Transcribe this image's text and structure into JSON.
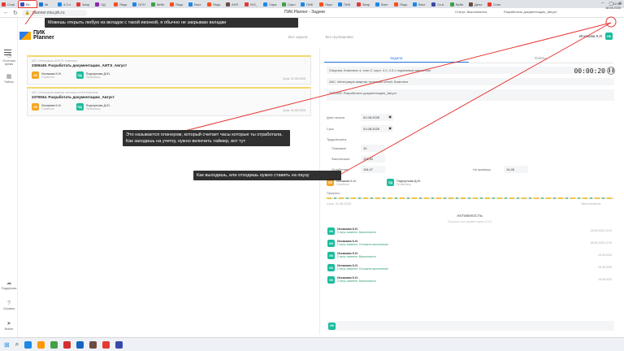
{
  "browser": {
    "tabs": [
      {
        "label": "Стан",
        "color": "#e53935"
      },
      {
        "label": "Вх: ",
        "color": "#3f51b5",
        "active": true
      },
      {
        "label": "Mi",
        "color": "#1976d2"
      },
      {
        "label": "4.3 п",
        "color": "#1e88e5"
      },
      {
        "label": "Запр",
        "color": "#e53935"
      },
      {
        "label": "ОД",
        "color": "#8e24aa"
      },
      {
        "label": "Яндс",
        "color": "#f4511e"
      },
      {
        "label": "ОСН",
        "color": "#1e88e5"
      },
      {
        "label": "Вебп",
        "color": "#43a047"
      },
      {
        "label": "Яндс",
        "color": "#f4511e"
      },
      {
        "label": "Вист",
        "color": "#1e88e5"
      },
      {
        "label": "Яндс",
        "color": "#f4511e"
      },
      {
        "label": "АНП",
        "color": "#6d4c41"
      },
      {
        "label": "002_",
        "color": "#e53935"
      },
      {
        "label": "Спра",
        "color": "#1e88e5"
      },
      {
        "label": "Сапо",
        "color": "#43a047"
      },
      {
        "label": "ПИК",
        "color": "#1e88e5"
      },
      {
        "label": "Перс",
        "color": "#f4511e"
      },
      {
        "label": "ПИК",
        "color": "#1e88e5"
      },
      {
        "label": "Запр",
        "color": "#e53935"
      },
      {
        "label": "Вист",
        "color": "#1e88e5"
      },
      {
        "label": "Яндс",
        "color": "#f4511e"
      },
      {
        "label": "Вист",
        "color": "#1e88e5"
      },
      {
        "label": "Ск.Ь.",
        "color": "#3949ab"
      },
      {
        "label": "Вебп",
        "color": "#43a047"
      },
      {
        "label": "Дело",
        "color": "#6d4c41"
      },
      {
        "label": "Стан",
        "color": "#e53935"
      }
    ],
    "url": "planner.mia.pik.ru",
    "title": "ПИК.Planner - Задачи"
  },
  "header": {
    "status_label": "Статус: Выполняется",
    "task_label": "Разработать документацию_Август",
    "view_tabs": [
      "Все задачи",
      "Без группировки"
    ],
    "user_name": "Исхакова К.И.",
    "user_initials": "ИК"
  },
  "logo": {
    "line1": "ПИК",
    "line2": "Planner"
  },
  "sidebar": {
    "items": [
      {
        "label": "Отчетная\nвремя",
        "icon": "clock-icon"
      },
      {
        "label": "Табель",
        "icon": "table-icon"
      },
      {
        "label": "Поддержка",
        "icon": "cloud-icon"
      },
      {
        "label": "Справка",
        "icon": "help-icon"
      },
      {
        "label": "Выйти",
        "icon": "send-icon"
      }
    ]
  },
  "tasks": [
    {
      "path": "АКС. Интеграция АСКУЭ. Комплекс",
      "name": "2369449. Разработать документацию_АИТЭ_Август",
      "assignee": {
        "name": "Исхакова К.И.",
        "role": "Отработал",
        "initials": "ИК"
      },
      "reviewer": {
        "name": "Подгорнова Д.Ю.",
        "role": "Проверяющ",
        "initials": "ПД"
      },
      "due": "Срок: 31.08.2025"
    },
    {
      "path": "АКС. Интеграция квартир тепловых сетей Комплекс",
      "name": "2370934. Разработать документацию_Август",
      "assignee": {
        "name": "Исхакова К.И.",
        "role": "Отработал",
        "initials": "ИК"
      },
      "reviewer": {
        "name": "Подгорнова Д.Ю.",
        "role": "Проверяющ",
        "initials": "ПД"
      },
      "due": "Срок: 31.08.2025"
    }
  ],
  "panel": {
    "tabs": [
      "Задача",
      "Файлы"
    ],
    "field1": "Озерная, Комплекс 4, этап 2, корп. 4.2, 4.3 с подземным паркингом",
    "field2": "АКС. Интеграция квартир тепловых сетей. Комплект",
    "field3": "2370934. Разработать документацию_Август",
    "timer": "00:00:20",
    "labels": {
      "start": "Дата начала",
      "end": "Срок",
      "labor": "Трудозатраты",
      "planned": "Плановые",
      "actual": "Фактические",
      "worked": "Отработано",
      "to_check": "На проверку",
      "progress": "Прогресс",
      "period": "Срок: 31.08.2025",
      "remaining": "Выполняется"
    },
    "values": {
      "start": "01.08.2025",
      "end": "31.08.2025",
      "planned": "10",
      "actual": "126,92",
      "worked": "116,47",
      "to_check": "14,46"
    },
    "people": [
      {
        "name": "Исхакова К.И.",
        "role": "Отработал",
        "initials": "ИК"
      },
      {
        "name": "Подгорнова Д.Ю.",
        "role": "Проверяющ",
        "initials": "ПД"
      }
    ]
  },
  "activity": {
    "title": "АКТИВНОСТЬ",
    "subtitle": "Показать все комментарии (137)",
    "items": [
      {
        "name": "Исхакова К.И.",
        "status": "Статус изменен: Выполняется",
        "time": "18.08.2025 12:00"
      },
      {
        "name": "Исхакова К.И.",
        "status": "Статус изменен: Отложено выполнение",
        "time": "18.08.2025 12:00"
      },
      {
        "name": "Исхакова К.И.",
        "status": "Статус изменен: Выполняется",
        "time": "18.08.2025"
      },
      {
        "name": "Исхакова К.И.",
        "status": "Статус изменен: Отложено выполнение",
        "time": "18.08.2025"
      },
      {
        "name": "Исхакова К.И.",
        "status": "Статус изменен: Выполняется",
        "time": "18.08.2025"
      }
    ],
    "composer_initials": "ИК"
  },
  "tooltips": {
    "tip1": "Можешь открыть любую из вкладок с такой иконкой, я обычно не закрываю вкладки",
    "tip2": "Это называется планером, который считает часы которые ты отработала. Как заходишь на учетку, нужно включить таймер, вот тут",
    "tip3": "Как выходишь, или отходишь нужно ставить на паузу"
  },
  "taskbar": {
    "time": "12:00",
    "date": "18.08.2025",
    "icon_colors": [
      "#1e88e5",
      "#ff9800",
      "#43a047",
      "#d32f2f",
      "#1565c0",
      "#6d4c41",
      "#e53935",
      "#3949ab"
    ]
  }
}
